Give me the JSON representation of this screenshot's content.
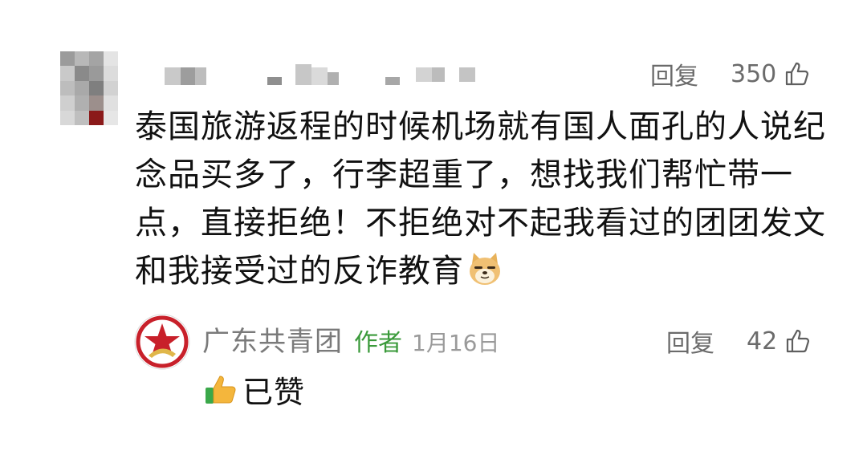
{
  "comment": {
    "author_name": "",
    "text": "泰国旅游返程的时候机场就有国人面孔的人说纪念品买多了，行李超重了，想找我们帮忙带一点，直接拒绝！不拒绝对不起我看过的团团发文和我接受过的反诈教育",
    "emoji": "doge-emoji",
    "reply_label": "回复",
    "like_count": "350"
  },
  "reply": {
    "author_name": "广东共青团",
    "author_badge": "作者",
    "date": "1月16日",
    "text": "已赞",
    "emoji": "thumbs-up-emoji",
    "reply_label": "回复",
    "like_count": "42"
  },
  "colors": {
    "meta_text": "#6b6b6b",
    "author_badge": "#3a9a3a",
    "logo_red": "#c8202a"
  },
  "icons": [
    "thumbs-up-outline-icon",
    "doge-emoji",
    "thumbs-up-emoji",
    "league-logo-icon"
  ]
}
